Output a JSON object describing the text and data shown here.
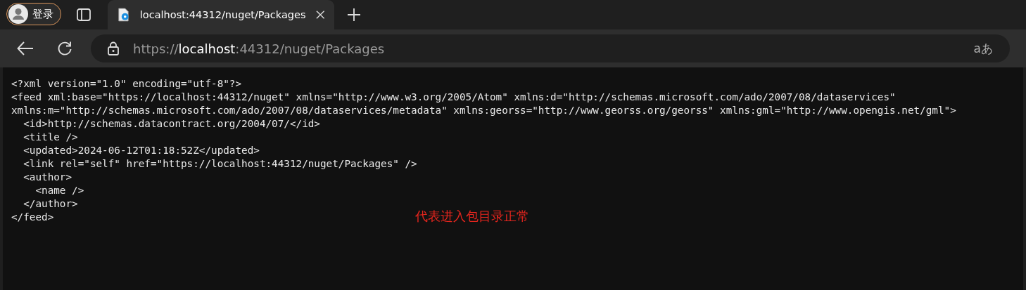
{
  "profile": {
    "label": "登录"
  },
  "tabs": [
    {
      "title": "localhost:44312/nuget/Packages",
      "selected": true
    }
  ],
  "address_bar": {
    "scheme": "https://",
    "host": "localhost",
    "rest": ":44312/nuget/Packages",
    "reader_label": "aあ"
  },
  "xml_lines": [
    "<?xml version=\"1.0\" encoding=\"utf-8\"?>",
    "<feed xml:base=\"https://localhost:44312/nuget\" xmlns=\"http://www.w3.org/2005/Atom\" xmlns:d=\"http://schemas.microsoft.com/ado/2007/08/dataservices\"",
    "xmlns:m=\"http://schemas.microsoft.com/ado/2007/08/dataservices/metadata\" xmlns:georss=\"http://www.georss.org/georss\" xmlns:gml=\"http://www.opengis.net/gml\">",
    "  <id>http://schemas.datacontract.org/2004/07/</id>",
    "  <title />",
    "  <updated>2024-06-12T01:18:52Z</updated>",
    "  <link rel=\"self\" href=\"https://localhost:44312/nuget/Packages\" />",
    "  <author>",
    "    <name />",
    "  </author>",
    "</feed>"
  ],
  "annotation": {
    "text": "代表进入包目录正常",
    "color": "#e8261e"
  }
}
